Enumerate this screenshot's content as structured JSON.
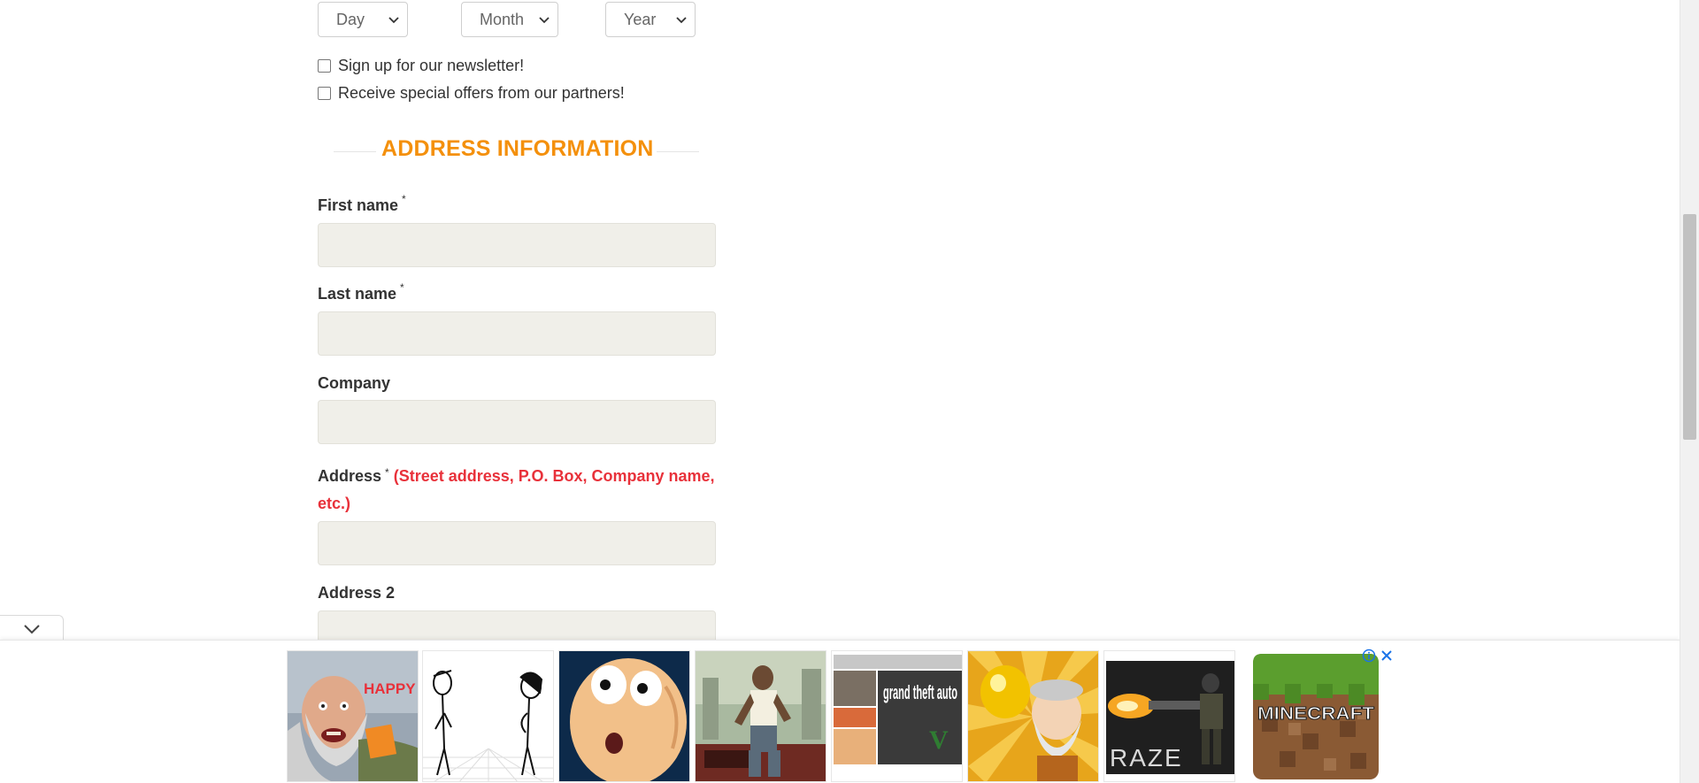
{
  "dob": {
    "day": {
      "selected": "Day"
    },
    "month": {
      "selected": "Month"
    },
    "year": {
      "selected": "Year"
    }
  },
  "checkboxes": {
    "newsletter": {
      "label": "Sign up for our newsletter!",
      "checked": false
    },
    "partners": {
      "label": "Receive special offers from our partners!",
      "checked": false
    }
  },
  "section": {
    "title": "ADDRESS INFORMATION",
    "color": "#f4900c"
  },
  "fields": {
    "first_name": {
      "label": "First name",
      "required": "*",
      "value": ""
    },
    "last_name": {
      "label": "Last name",
      "required": "*",
      "value": ""
    },
    "company": {
      "label": "Company",
      "value": ""
    },
    "address": {
      "label": "Address",
      "required": "*",
      "hint": "(Street address, P.O. Box, Company name, etc.)",
      "value": ""
    },
    "address2": {
      "label": "Address 2",
      "value": ""
    }
  },
  "ads": {
    "items": [
      {
        "name": "happy-wheels",
        "text": "HAPPY WHEELS"
      },
      {
        "name": "stick-figures",
        "text": ""
      },
      {
        "name": "cartoon-face",
        "text": ""
      },
      {
        "name": "gta-san-andreas",
        "text": ""
      },
      {
        "name": "gta-v",
        "text": "grand theft auto"
      },
      {
        "name": "gold-miner",
        "text": ""
      },
      {
        "name": "raze",
        "text": "RAZE"
      },
      {
        "name": "minecraft",
        "text": "MINECRAFT"
      }
    ],
    "info_icon": "info-icon",
    "close_icon": "close-icon"
  },
  "colors": {
    "accent": "#f4900c",
    "hint": "#e8313a",
    "input_bg": "#f0efe9"
  }
}
